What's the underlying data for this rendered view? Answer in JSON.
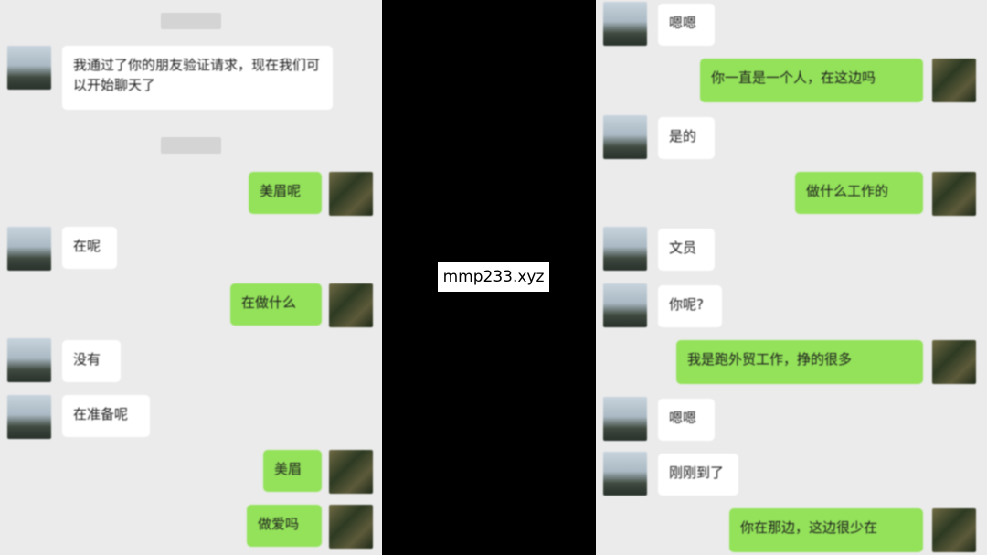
{
  "watermark": "mmp233.xyz",
  "colors": {
    "chat_background": "#ebebeb",
    "incoming_bubble": "#ffffff",
    "outgoing_bubble": "#93e25a",
    "separator": "#000000"
  },
  "left_chat": {
    "messages": [
      {
        "direction": "incoming",
        "text": "我通过了你的朋友验证请求，现在我们可以开始聊天了"
      },
      {
        "direction": "outgoing",
        "text": "美眉呢"
      },
      {
        "direction": "incoming",
        "text": "在呢"
      },
      {
        "direction": "outgoing",
        "text": "在做什么"
      },
      {
        "direction": "incoming",
        "text": "没有"
      },
      {
        "direction": "incoming",
        "text": "在准备呢"
      },
      {
        "direction": "outgoing",
        "text": "美眉"
      },
      {
        "direction": "outgoing",
        "text": "做爱吗"
      }
    ]
  },
  "right_chat": {
    "messages": [
      {
        "direction": "incoming",
        "text": "嗯嗯"
      },
      {
        "direction": "outgoing",
        "text": "你一直是一个人，在这边吗"
      },
      {
        "direction": "incoming",
        "text": "是的"
      },
      {
        "direction": "outgoing",
        "text": "做什么工作的"
      },
      {
        "direction": "incoming",
        "text": "文员"
      },
      {
        "direction": "incoming",
        "text": "你呢?"
      },
      {
        "direction": "outgoing",
        "text": "我是跑外贸工作，挣的很多"
      },
      {
        "direction": "incoming",
        "text": "嗯嗯"
      },
      {
        "direction": "incoming",
        "text": "刚刚到了"
      },
      {
        "direction": "outgoing",
        "text": "你在那边，这边很少在"
      }
    ]
  }
}
